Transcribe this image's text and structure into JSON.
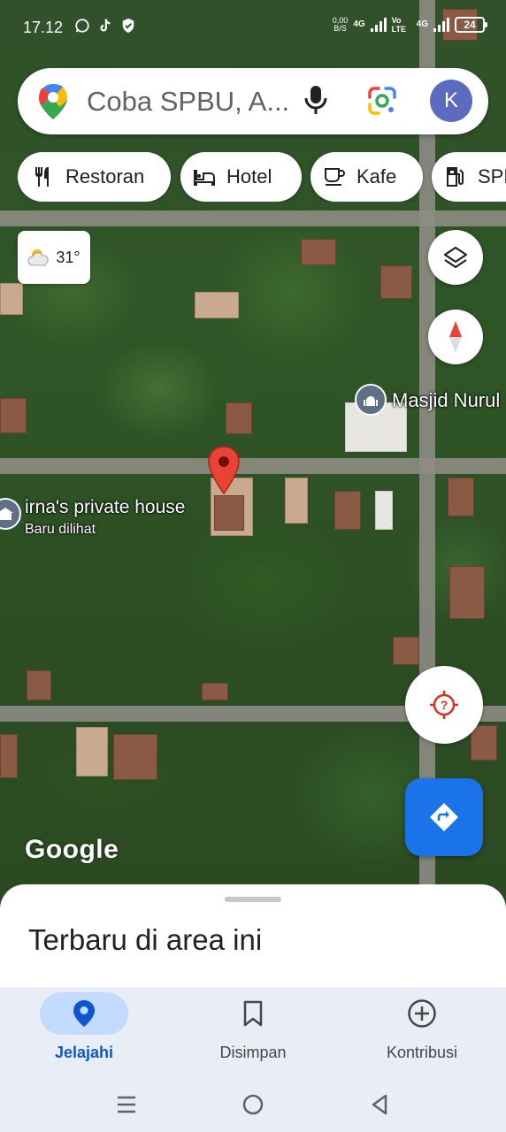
{
  "status_bar": {
    "time": "17.12",
    "net_speed_value": "0,00",
    "net_speed_unit": "B/S",
    "net_type_1": "4G",
    "volte": "Vo LTE",
    "net_type_2": "4G",
    "battery": "24"
  },
  "search": {
    "placeholder": "Coba SPBU, A...",
    "avatar_letter": "K"
  },
  "chips": [
    {
      "label": "Restoran",
      "icon": "fork-knife-icon"
    },
    {
      "label": "Hotel",
      "icon": "bed-icon"
    },
    {
      "label": "Kafe",
      "icon": "coffee-icon"
    },
    {
      "label": "SPBU",
      "icon": "gas-pump-icon"
    }
  ],
  "weather": {
    "temp": "31°",
    "icon": "partly-cloudy-icon"
  },
  "map": {
    "poi_mosque": "Masjid Nurul",
    "poi_house": "irna's private house",
    "poi_house_sub": "Baru dilihat",
    "watermark": "Google"
  },
  "sheet": {
    "title": "Terbaru di area ini"
  },
  "nav": [
    {
      "label": "Jelajahi",
      "icon": "location-pin-icon",
      "active": true
    },
    {
      "label": "Disimpan",
      "icon": "bookmark-icon",
      "active": false
    },
    {
      "label": "Kontribusi",
      "icon": "add-circle-icon",
      "active": false
    }
  ],
  "colors": {
    "accent": "#1a73e8",
    "active_nav": "#0b57d0",
    "pin": "#ea4335"
  }
}
